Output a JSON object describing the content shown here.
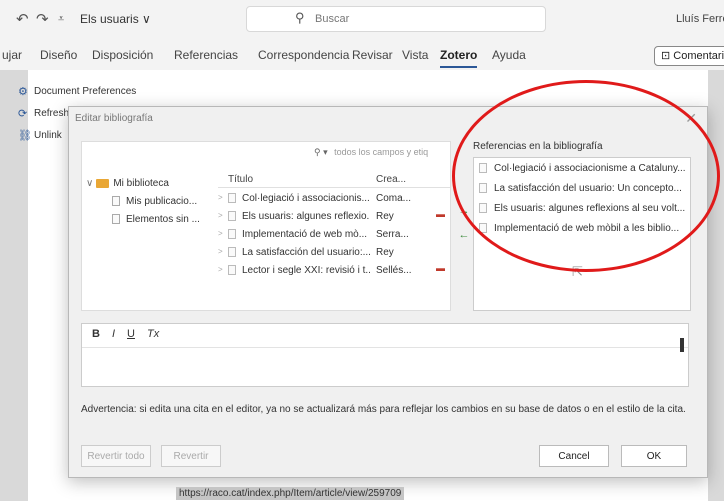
{
  "title_bar": {
    "quick_access": {
      "undo": "↶",
      "redo": "↷",
      "customize": "⩡"
    },
    "filename": "Els usuaris ∨",
    "search_placeholder": "Buscar",
    "search_icon": "⚲",
    "user_name": "Lluís Ferreres"
  },
  "ribbon": {
    "tabs": [
      "ujar",
      "Diseño",
      "Disposición",
      "Referencias",
      "Correspondencia",
      "Revisar",
      "Vista",
      "Zotero",
      "Ayuda"
    ],
    "active_tab": "Zotero",
    "comment_label": "⊡ Comentarios"
  },
  "zotero_menu": [
    {
      "icon": "gear-icon",
      "glyph": "⚙",
      "label": "Document Preferences"
    },
    {
      "icon": "refresh-icon",
      "glyph": "⟳",
      "label": "Refresh"
    },
    {
      "icon": "unlink-icon",
      "glyph": "⛓",
      "label": "Unlink"
    }
  ],
  "document": {
    "url_text": "https://raco.cat/index.php/Item/article/view/259709"
  },
  "dialog": {
    "title": "Editar bibliografía",
    "close_glyph": "✕",
    "filter_icon": "⚲ ▾",
    "filter_placeholder": "todos los campos y etiq",
    "library_tree": [
      {
        "label": "Mi biblioteca",
        "expand": "∨",
        "kind": "folder"
      },
      {
        "label": "Mis publicacio...",
        "kind": "sub"
      },
      {
        "label": "Elementos sin ...",
        "kind": "sub"
      }
    ],
    "columns": {
      "title": "Título",
      "creator": "Crea..."
    },
    "items": [
      {
        "title": "Col·legiació i associacionis...",
        "creator": "Coma...",
        "pin": ""
      },
      {
        "title": "Els usuaris: algunes reflexio...",
        "creator": "Rey",
        "pin": "▬"
      },
      {
        "title": "Implementació de web mò...",
        "creator": "Serra...",
        "pin": ""
      },
      {
        "title": "La satisfacción del usuario:...",
        "creator": "Rey",
        "pin": ""
      },
      {
        "title": "Lector i segle XXI: revisió i t...",
        "creator": "Sellés...",
        "pin": "▬"
      }
    ],
    "move_arrows": [
      "→",
      "←"
    ],
    "bibliography_label": "Referencias en la bibliografía",
    "bibliography": [
      "Col·legiació i associacionisme a Cataluny...",
      "La satisfacción del usuario: Un concepto...",
      "Els usuaris: algunes reflexions al seu volt...",
      "Implementació de web mòbil a les biblio..."
    ],
    "cursor_glyph": "⇱",
    "editor_buttons": [
      "B",
      "I",
      "U",
      "Tx"
    ],
    "warning": "Advertencia: si edita una cita en el editor, ya no se actualizará más para reflejar los cambios en su base de datos o en el estilo de la cita.",
    "buttons": {
      "revert_all": "Revertir todo",
      "revert": "Revertir",
      "cancel": "Cancel",
      "ok": "OK"
    }
  }
}
